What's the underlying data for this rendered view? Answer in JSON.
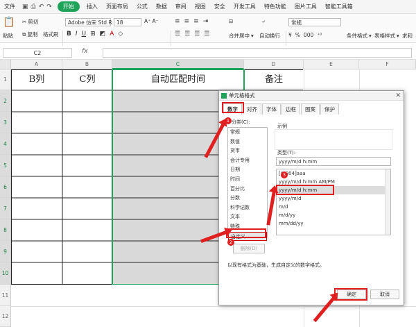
{
  "menubar": {
    "file": "文件",
    "start": "开始",
    "items": [
      "插入",
      "页面布局",
      "公式",
      "数据",
      "审阅",
      "视图",
      "安全",
      "开发工具",
      "特色功能",
      "图片工具",
      "智能工具箱"
    ]
  },
  "ribbon": {
    "paste": "粘贴",
    "cut": "剪切",
    "copy": "复制",
    "format_painter": "格式刷",
    "font": "Adobe 仿宋 Std R",
    "size": "18",
    "merge": "合并居中",
    "wrap": "自动换行",
    "number_format": "常规",
    "cond_format": "条件格式",
    "table_style": "表格样式",
    "sum": "求和"
  },
  "formula": {
    "cell": "C2",
    "fx": "fx"
  },
  "columns": [
    "A",
    "B",
    "C",
    "D",
    "E",
    "F"
  ],
  "rows": [
    "1",
    "2",
    "3",
    "4",
    "5",
    "6",
    "7",
    "8",
    "9",
    "10",
    "11",
    "12"
  ],
  "headers": {
    "b": "B列",
    "c": "C列",
    "time": "自动匹配时间",
    "note": "备注"
  },
  "dialog": {
    "title": "单元格格式",
    "tabs": [
      "数字",
      "对齐",
      "字体",
      "边框",
      "图案",
      "保护"
    ],
    "category_label": "分类(C):",
    "categories": [
      "常规",
      "数值",
      "货币",
      "会计专用",
      "日期",
      "时间",
      "百分比",
      "分数",
      "科学记数",
      "文本",
      "特殊",
      "自定义"
    ],
    "sample_label": "示例",
    "type_label": "类型(T):",
    "type_value": "yyyy/m/d h:mm",
    "types": [
      "[$-804]aaa",
      "yyyy/m/d h:mm AM/PM",
      "yyyy/m/d h:mm",
      "yyyy/m/d",
      "m/d",
      "m/d/yy",
      "mm/dd/yy"
    ],
    "delete": "删除(D)",
    "hint": "以现有格式为基础，生成自定义的数字格式。",
    "ok": "确定",
    "cancel": "取消"
  },
  "badges": [
    "1",
    "2",
    "3"
  ]
}
